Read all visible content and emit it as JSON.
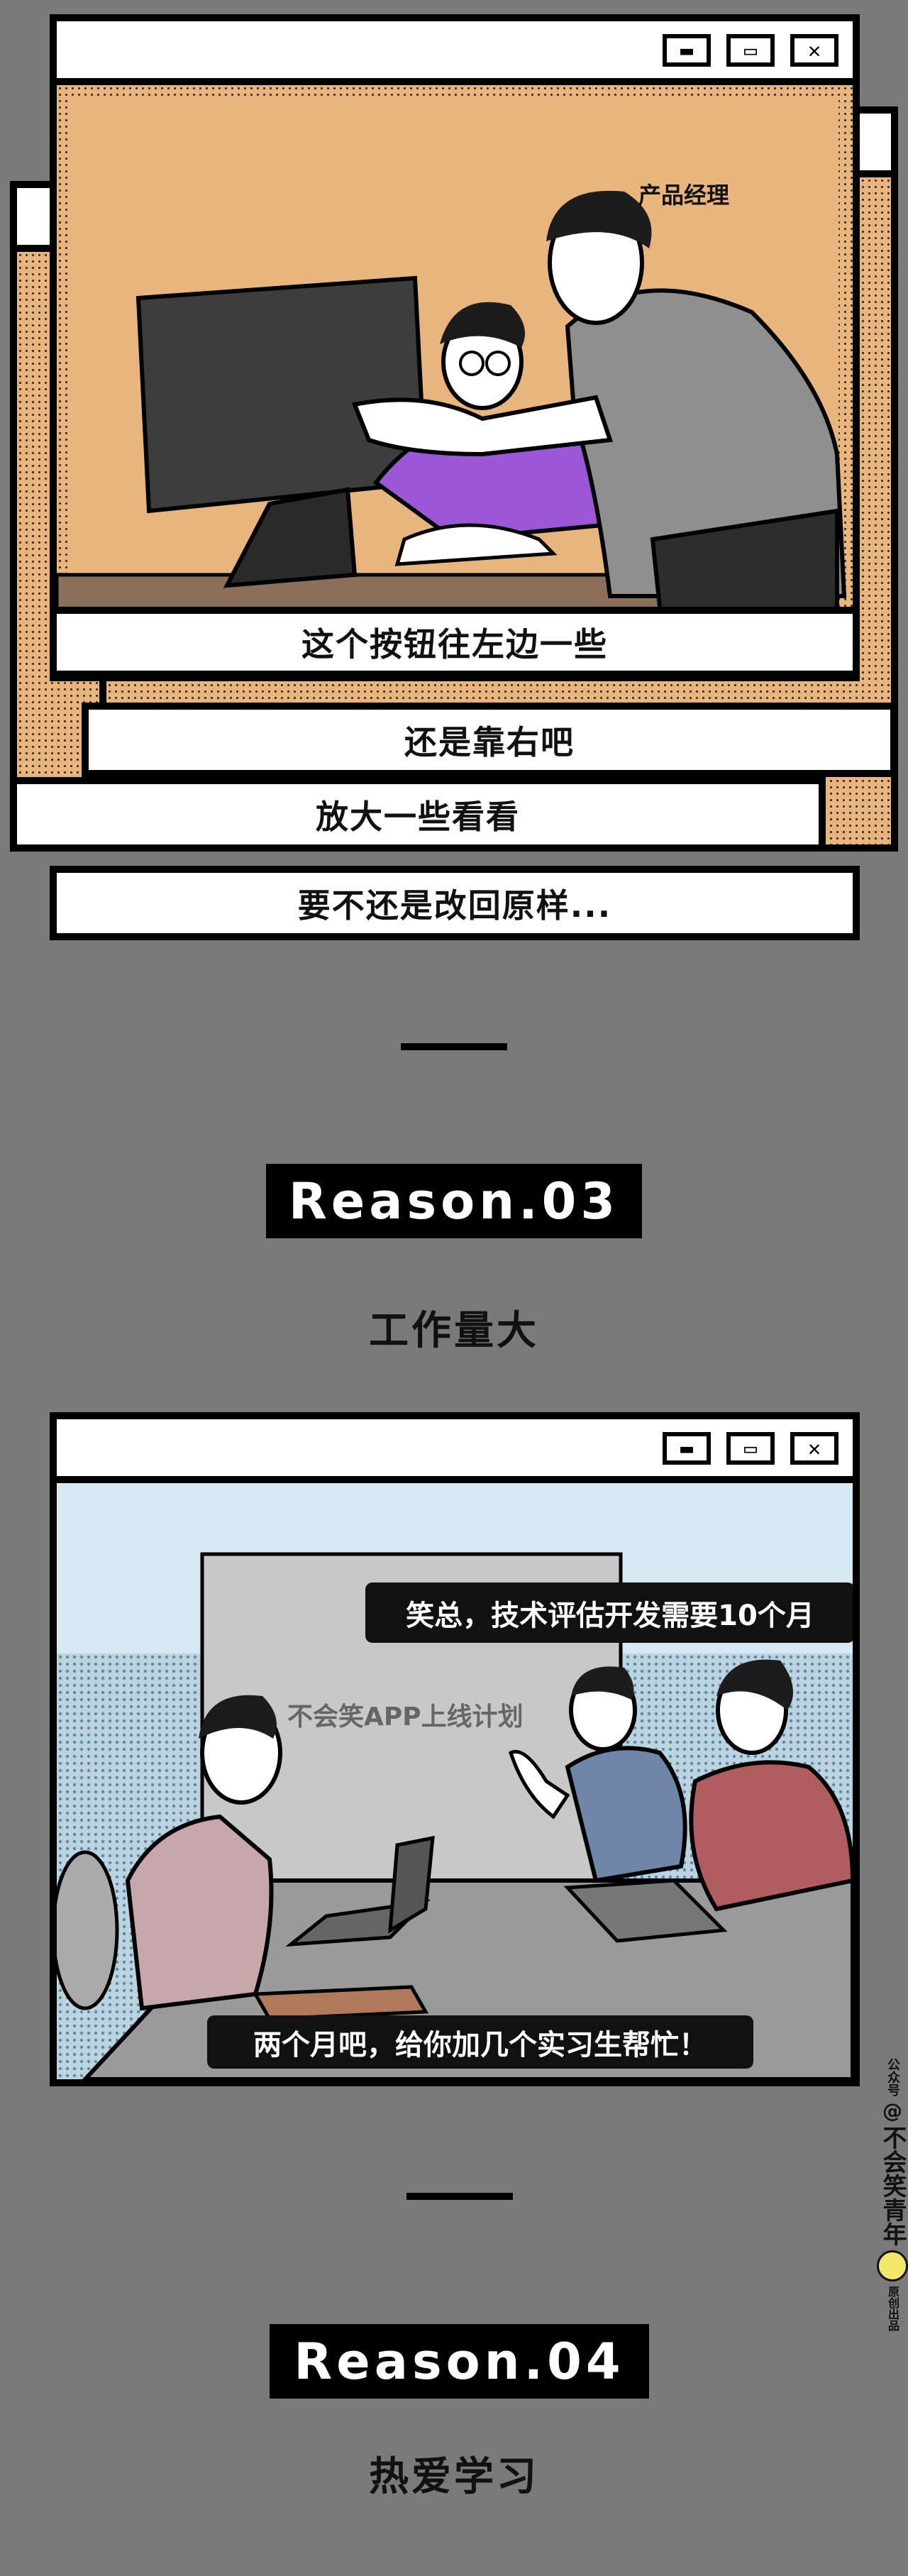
{
  "panel1": {
    "label": "产品经理",
    "captions": [
      "这个按钮往左边一些",
      "还是靠右吧",
      "放大一些看看",
      "要不还是改回原样..."
    ],
    "window_buttons": [
      "minimize-icon",
      "maximize-icon",
      "close-icon"
    ]
  },
  "section3": {
    "badge": "Reason.03",
    "title": "工作量大"
  },
  "panel2": {
    "board_text": "不会笑APP上线计划",
    "bubble_top": "笑总，技术评估开发需要10个月",
    "bubble_bottom": "两个月吧，给你加几个实习生帮忙！",
    "window_buttons": [
      "minimize-icon",
      "maximize-icon",
      "close-icon"
    ]
  },
  "section4": {
    "badge": "Reason.04",
    "title": "热爱学习"
  },
  "watermark": {
    "top": "公众号",
    "at": "@",
    "name": "不会笑青年",
    "bottom": "原创出品"
  },
  "colors": {
    "background": "#7a7a7a",
    "panel1_bg": "#e8b57f",
    "shirt_purple": "#9b57d6",
    "panel2_sky": "#d6e8f2",
    "panel2_dots": "#7fa6bd"
  }
}
